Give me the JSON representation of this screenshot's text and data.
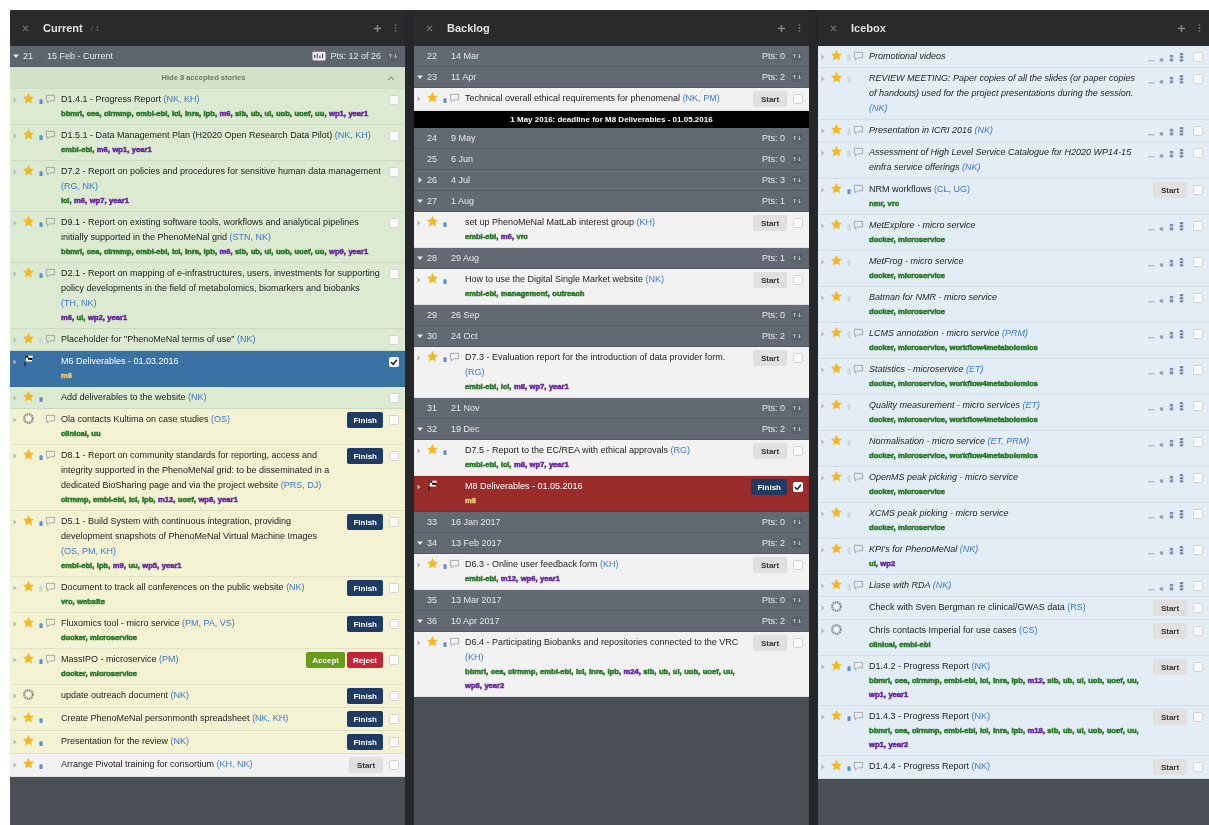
{
  "panels": [
    {
      "title": "Current",
      "count": "/ 1",
      "items": [
        {
          "kind": "iteration",
          "current": true,
          "expanded": true,
          "number": "21",
          "date": "15 Feb - Current",
          "points": "Pts: 12 of 26"
        },
        {
          "kind": "banner",
          "text": "Hide 8 accepted stories",
          "expanded": true
        },
        {
          "kind": "feature",
          "color": "#dbead0",
          "estimated": true,
          "comments": true,
          "title": "D1.4.1 - Progress Report",
          "owners": "(NK, KH)",
          "checked": false,
          "labels": [
            {
              "text": "bbmri,",
              "color": "#2f7a2f"
            },
            {
              "text": "cea,",
              "color": "#2f7a2f"
            },
            {
              "text": "cirmmp,",
              "color": "#2f7a2f"
            },
            {
              "text": "embl-ebi,",
              "color": "#2f7a2f"
            },
            {
              "text": "icl,",
              "color": "#2f7a2f"
            },
            {
              "text": "inra,",
              "color": "#2f7a2f"
            },
            {
              "text": "ipb,",
              "color": "#2f7a2f"
            },
            {
              "text": "m6,",
              "color": "#6a2c9e"
            },
            {
              "text": "sib,",
              "color": "#2f7a2f"
            },
            {
              "text": "ub,",
              "color": "#2f7a2f"
            },
            {
              "text": "ul,",
              "color": "#2f7a2f"
            },
            {
              "text": "uob,",
              "color": "#2f7a2f"
            },
            {
              "text": "uoef,",
              "color": "#2f7a2f"
            },
            {
              "text": "uu,",
              "color": "#2f7a2f"
            },
            {
              "text": "wp1,",
              "color": "#6a2c9e"
            },
            {
              "text": "year1",
              "color": "#6a2c9e"
            }
          ]
        },
        {
          "kind": "feature",
          "color": "#dbead0",
          "estimated": true,
          "comments": true,
          "title": "D1.5.1 - Data Management Plan (H2020 Open Research Data Pilot)",
          "owners": "(NK, KH)",
          "checked": false,
          "labels": [
            {
              "text": "embl-ebi,",
              "color": "#2f7a2f"
            },
            {
              "text": "m6,",
              "color": "#6a2c9e"
            },
            {
              "text": "wp1,",
              "color": "#6a2c9e"
            },
            {
              "text": "year1",
              "color": "#6a2c9e"
            }
          ]
        },
        {
          "kind": "feature",
          "color": "#dbead0",
          "estimated": true,
          "comments": true,
          "title": "D7.2 - Report on policies and procedures for sensitive human data management",
          "owners": "(RG, NK)",
          "checked": false,
          "labels": [
            {
              "text": "icl,",
              "color": "#2f7a2f"
            },
            {
              "text": "m6,",
              "color": "#6a2c9e"
            },
            {
              "text": "wp7,",
              "color": "#6a2c9e"
            },
            {
              "text": "year1",
              "color": "#6a2c9e"
            }
          ]
        },
        {
          "kind": "feature",
          "color": "#dbead0",
          "estimated": true,
          "comments": true,
          "title": "D9.1 - Report on existing software tools, workflows and analytical pipelines initially supported in the PhenoMeNal grid",
          "owners": "(STN, NK)",
          "checked": false,
          "labels": [
            {
              "text": "bbmri,",
              "color": "#2f7a2f"
            },
            {
              "text": "cea,",
              "color": "#2f7a2f"
            },
            {
              "text": "cirmmp,",
              "color": "#2f7a2f"
            },
            {
              "text": "embl-ebi,",
              "color": "#2f7a2f"
            },
            {
              "text": "icl,",
              "color": "#2f7a2f"
            },
            {
              "text": "inra,",
              "color": "#2f7a2f"
            },
            {
              "text": "ipb,",
              "color": "#2f7a2f"
            },
            {
              "text": "m6,",
              "color": "#6a2c9e"
            },
            {
              "text": "sib,",
              "color": "#2f7a2f"
            },
            {
              "text": "ub,",
              "color": "#2f7a2f"
            },
            {
              "text": "ul,",
              "color": "#2f7a2f"
            },
            {
              "text": "uob,",
              "color": "#2f7a2f"
            },
            {
              "text": "uoef,",
              "color": "#2f7a2f"
            },
            {
              "text": "uu,",
              "color": "#2f7a2f"
            },
            {
              "text": "wp9,",
              "color": "#6a2c9e"
            },
            {
              "text": "year1",
              "color": "#6a2c9e"
            }
          ]
        },
        {
          "kind": "feature",
          "color": "#dbead0",
          "estimated": true,
          "comments": true,
          "title": "D2.1 - Report on mapping of e-infrastructures, users, investments for supporting policy developments in the field of metabolomics, biomarkers and biobanks",
          "owners": "(TH, NK)",
          "checked": false,
          "labels": [
            {
              "text": "m6,",
              "color": "#6a2c9e"
            },
            {
              "text": "ul,",
              "color": "#2f7a2f"
            },
            {
              "text": "wp2,",
              "color": "#6a2c9e"
            },
            {
              "text": "year1",
              "color": "#6a2c9e"
            }
          ]
        },
        {
          "kind": "feature",
          "color": "#dbead0",
          "estimated": false,
          "comments": true,
          "title": "Placeholder for \"PhenoMeNal terms of use\"",
          "owners": "(NK)",
          "checked": false
        },
        {
          "kind": "release",
          "color": "#3a72a3",
          "title": "M6 Deliverables - 01.03.2016",
          "checked": true,
          "labels": [
            {
              "text": "m6",
              "color": "#e9c46a"
            }
          ]
        },
        {
          "kind": "feature",
          "color": "#dbead0",
          "estimated": true,
          "comments": false,
          "title": "Add deliverables to the website",
          "owners": "(NK)",
          "checked": false
        },
        {
          "kind": "chore",
          "color": "#f3f2d3",
          "comments": true,
          "title": "Ola contacts Kultima on case studies",
          "owners": "(OS)",
          "checked": false,
          "actions": [
            {
              "label": "Finish",
              "kind": "finish"
            }
          ],
          "labels": [
            {
              "text": "clinical,",
              "color": "#2f7a2f"
            },
            {
              "text": "uu",
              "color": "#2f7a2f"
            }
          ]
        },
        {
          "kind": "feature",
          "color": "#f3f2d3",
          "estimated": true,
          "comments": true,
          "title": "D8.1 - Report on community standards for reporting, access and integrity supported in the PhenoMeNal grid: to be disseminated in a dedicated BioSharing page and via the project website",
          "owners": "(PRS, DJ)",
          "checked": false,
          "actions": [
            {
              "label": "Finish",
              "kind": "finish"
            }
          ],
          "labels": [
            {
              "text": "cirmmp,",
              "color": "#2f7a2f"
            },
            {
              "text": "embl-ebi,",
              "color": "#2f7a2f"
            },
            {
              "text": "icl,",
              "color": "#2f7a2f"
            },
            {
              "text": "ipb,",
              "color": "#2f7a2f"
            },
            {
              "text": "m12,",
              "color": "#6a2c9e"
            },
            {
              "text": "uoef,",
              "color": "#2f7a2f"
            },
            {
              "text": "wp8,",
              "color": "#6a2c9e"
            },
            {
              "text": "year1",
              "color": "#6a2c9e"
            }
          ]
        },
        {
          "kind": "feature",
          "color": "#f3f2d3",
          "estimated": true,
          "comments": true,
          "title": "D5.1 - Build System with continuous integration, providing development snapshots of PhenoMeNal Virtual Machine Images",
          "owners": "(OS, PM, KH)",
          "checked": false,
          "actions": [
            {
              "label": "Finish",
              "kind": "finish"
            }
          ],
          "labels": [
            {
              "text": "embl-ebi,",
              "color": "#2f7a2f"
            },
            {
              "text": "ipb,",
              "color": "#2f7a2f"
            },
            {
              "text": "m9,",
              "color": "#6a2c9e"
            },
            {
              "text": "uu,",
              "color": "#2f7a2f"
            },
            {
              "text": "wp5,",
              "color": "#6a2c9e"
            },
            {
              "text": "year1",
              "color": "#6a2c9e"
            }
          ]
        },
        {
          "kind": "feature",
          "color": "#f3f2d3",
          "estimated": false,
          "comments": true,
          "title": "Document to track all conferences on the public website",
          "owners": "(NK)",
          "checked": false,
          "actions": [
            {
              "label": "Finish",
              "kind": "finish"
            }
          ],
          "labels": [
            {
              "text": "vrc,",
              "color": "#2f7a2f"
            },
            {
              "text": "website",
              "color": "#2f7a2f"
            }
          ]
        },
        {
          "kind": "feature",
          "color": "#f3f2d3",
          "estimated": true,
          "comments": true,
          "title": "Fluxomics tool - micro service",
          "owners": "(PM, PA, VS)",
          "checked": false,
          "actions": [
            {
              "label": "Finish",
              "kind": "finish"
            }
          ],
          "labels": [
            {
              "text": "docker,",
              "color": "#2f7a2f"
            },
            {
              "text": "microservice",
              "color": "#2f7a2f"
            }
          ]
        },
        {
          "kind": "feature",
          "color": "#f3f2d3",
          "estimated": true,
          "comments": true,
          "title": "MassIPO - microservice",
          "owners": "(PM)",
          "checked": false,
          "actions": [
            {
              "label": "Accept",
              "kind": "accept"
            },
            {
              "label": "Reject",
              "kind": "reject"
            }
          ],
          "labels": [
            {
              "text": "docker,",
              "color": "#2f7a2f"
            },
            {
              "text": "microservice",
              "color": "#2f7a2f"
            }
          ]
        },
        {
          "kind": "chore",
          "color": "#f3f2d3",
          "comments": false,
          "title": "update outreach document",
          "owners": "(NK)",
          "checked": false,
          "actions": [
            {
              "label": "Finish",
              "kind": "finish"
            }
          ]
        },
        {
          "kind": "feature",
          "color": "#f3f2d3",
          "estimated": true,
          "comments": false,
          "title": "Create PhenoMeNal personmonth spreadsheet",
          "owners": "(NK, KH)",
          "checked": false,
          "actions": [
            {
              "label": "Finish",
              "kind": "finish"
            }
          ]
        },
        {
          "kind": "feature",
          "color": "#f3f2d3",
          "estimated": true,
          "comments": false,
          "title": "Presentation for the review",
          "owners": "(NK)",
          "checked": false,
          "actions": [
            {
              "label": "Finish",
              "kind": "finish"
            }
          ]
        },
        {
          "kind": "feature",
          "color": "#f2f2f2",
          "estimated": true,
          "comments": false,
          "title": "Arrange Pivotal training for consortium",
          "owners": "(KH, NK)",
          "checked": false,
          "actions": [
            {
              "label": "Start",
              "kind": "start"
            }
          ]
        }
      ]
    },
    {
      "title": "Backlog",
      "items": [
        {
          "kind": "iteration",
          "current": false,
          "number": "22",
          "date": "14 Mar",
          "points": "Pts: 0"
        },
        {
          "kind": "iteration",
          "current": false,
          "expanded": true,
          "number": "23",
          "date": "11 Apr",
          "points": "Pts: 2"
        },
        {
          "kind": "feature",
          "color": "#f2f2f2",
          "estimated": true,
          "comments": true,
          "title": "Technical overall ethical requirements for phenomenal",
          "owners": "(NK, PM)",
          "checked": false,
          "actions": [
            {
              "label": "Start",
              "kind": "start"
            }
          ]
        },
        {
          "kind": "marker",
          "text": "1 May 2016: deadline for M8 Deliverables - 01.05.2016"
        },
        {
          "kind": "iteration",
          "current": false,
          "number": "24",
          "date": "9 May",
          "points": "Pts: 0"
        },
        {
          "kind": "iteration",
          "current": false,
          "number": "25",
          "date": "6 Jun",
          "points": "Pts: 0"
        },
        {
          "kind": "iteration",
          "current": false,
          "expanded": false,
          "number": "26",
          "date": "4 Jul",
          "points": "Pts: 3"
        },
        {
          "kind": "iteration",
          "current": false,
          "expanded": true,
          "number": "27",
          "date": "1 Aug",
          "points": "Pts: 1"
        },
        {
          "kind": "feature",
          "color": "#f2f2f2",
          "estimated": true,
          "comments": false,
          "title": "set up PhenoMeNal MatLab interest group",
          "owners": "(KH)",
          "checked": false,
          "actions": [
            {
              "label": "Start",
              "kind": "start"
            }
          ],
          "labels": [
            {
              "text": "embl-ebi,",
              "color": "#2f7a2f"
            },
            {
              "text": "m6,",
              "color": "#6a2c9e"
            },
            {
              "text": "vrc",
              "color": "#2f7a2f"
            }
          ]
        },
        {
          "kind": "iteration",
          "current": false,
          "expanded": true,
          "number": "28",
          "date": "29 Aug",
          "points": "Pts: 1"
        },
        {
          "kind": "feature",
          "color": "#f2f2f2",
          "estimated": true,
          "comments": false,
          "title": "How to use the Digital Single Market website",
          "owners": "(NK)",
          "checked": false,
          "actions": [
            {
              "label": "Start",
              "kind": "start"
            }
          ],
          "labels": [
            {
              "text": "embl-ebi,",
              "color": "#2f7a2f"
            },
            {
              "text": "management,",
              "color": "#2f7a2f"
            },
            {
              "text": "outreach",
              "color": "#2f7a2f"
            }
          ]
        },
        {
          "kind": "iteration",
          "current": false,
          "number": "29",
          "date": "26 Sep",
          "points": "Pts: 0"
        },
        {
          "kind": "iteration",
          "current": false,
          "expanded": true,
          "number": "30",
          "date": "24 Oct",
          "points": "Pts: 2"
        },
        {
          "kind": "feature",
          "color": "#f2f2f2",
          "estimated": true,
          "comments": true,
          "title": "D7.3 - Evaluation report for the introduction of data provider form.",
          "owners": "(RG)",
          "checked": false,
          "actions": [
            {
              "label": "Start",
              "kind": "start"
            }
          ],
          "labels": [
            {
              "text": "embl-ebi,",
              "color": "#2f7a2f"
            },
            {
              "text": "icl,",
              "color": "#2f7a2f"
            },
            {
              "text": "m8,",
              "color": "#6a2c9e"
            },
            {
              "text": "wp7,",
              "color": "#6a2c9e"
            },
            {
              "text": "year1",
              "color": "#6a2c9e"
            }
          ]
        },
        {
          "kind": "iteration",
          "current": false,
          "number": "31",
          "date": "21 Nov",
          "points": "Pts: 0"
        },
        {
          "kind": "iteration",
          "current": false,
          "expanded": true,
          "number": "32",
          "date": "19 Dec",
          "points": "Pts: 2"
        },
        {
          "kind": "feature",
          "color": "#f2f2f2",
          "estimated": true,
          "comments": false,
          "title": "D7.5 - Report to the EC/REA with ethical approvals",
          "owners": "(RG)",
          "checked": false,
          "actions": [
            {
              "label": "Start",
              "kind": "start"
            }
          ],
          "labels": [
            {
              "text": "embl-ebi,",
              "color": "#2f7a2f"
            },
            {
              "text": "icl,",
              "color": "#2f7a2f"
            },
            {
              "text": "m8,",
              "color": "#6a2c9e"
            },
            {
              "text": "wp7,",
              "color": "#6a2c9e"
            },
            {
              "text": "year1",
              "color": "#6a2c9e"
            }
          ]
        },
        {
          "kind": "release",
          "color": "#992c2b",
          "title": "M8 Deliverables - 01.05.2016",
          "checked": true,
          "actions": [
            {
              "label": "Finish",
              "kind": "finish"
            }
          ],
          "labels": [
            {
              "text": "m8",
              "color": "#e9c46a"
            }
          ]
        },
        {
          "kind": "iteration",
          "current": false,
          "number": "33",
          "date": "16 Jan 2017",
          "points": "Pts: 0"
        },
        {
          "kind": "iteration",
          "current": false,
          "expanded": true,
          "number": "34",
          "date": "13 Feb 2017",
          "points": "Pts: 2"
        },
        {
          "kind": "feature",
          "color": "#f2f2f2",
          "estimated": true,
          "comments": true,
          "title": "D6.3 - Online user feedback form",
          "owners": "(KH)",
          "checked": false,
          "actions": [
            {
              "label": "Start",
              "kind": "start"
            }
          ],
          "labels": [
            {
              "text": "embl-ebi,",
              "color": "#2f7a2f"
            },
            {
              "text": "m12,",
              "color": "#6a2c9e"
            },
            {
              "text": "wp6,",
              "color": "#6a2c9e"
            },
            {
              "text": "year1",
              "color": "#6a2c9e"
            }
          ]
        },
        {
          "kind": "iteration",
          "current": false,
          "number": "35",
          "date": "13 Mar 2017",
          "points": "Pts: 0"
        },
        {
          "kind": "iteration",
          "current": false,
          "expanded": true,
          "number": "36",
          "date": "10 Apr 2017",
          "points": "Pts: 2"
        },
        {
          "kind": "feature",
          "color": "#f2f2f2",
          "estimated": true,
          "comments": true,
          "title": "D6.4 - Participating Biobanks and repositories connected to the VRC",
          "owners": "(KH)",
          "checked": false,
          "actions": [
            {
              "label": "Start",
              "kind": "start"
            }
          ],
          "labels": [
            {
              "text": "bbmri,",
              "color": "#2f7a2f"
            },
            {
              "text": "cea,",
              "color": "#2f7a2f"
            },
            {
              "text": "cirmmp,",
              "color": "#2f7a2f"
            },
            {
              "text": "embl-ebi,",
              "color": "#2f7a2f"
            },
            {
              "text": "icl,",
              "color": "#2f7a2f"
            },
            {
              "text": "inra,",
              "color": "#2f7a2f"
            },
            {
              "text": "ipb,",
              "color": "#2f7a2f"
            },
            {
              "text": "m24,",
              "color": "#6a2c9e"
            },
            {
              "text": "sib,",
              "color": "#2f7a2f"
            },
            {
              "text": "ub,",
              "color": "#2f7a2f"
            },
            {
              "text": "ul,",
              "color": "#2f7a2f"
            },
            {
              "text": "uob,",
              "color": "#2f7a2f"
            },
            {
              "text": "uoef,",
              "color": "#2f7a2f"
            },
            {
              "text": "uu,",
              "color": "#2f7a2f"
            },
            {
              "text": "wp8,",
              "color": "#6a2c9e"
            },
            {
              "text": "year2",
              "color": "#6a2c9e"
            }
          ]
        }
      ]
    },
    {
      "title": "Icebox",
      "items": [
        {
          "kind": "feature",
          "color": "#e3edf6",
          "estimated": false,
          "comments": true,
          "estimate_picker": true,
          "title": "Promotional videos",
          "checked": false
        },
        {
          "kind": "feature",
          "color": "#e3edf6",
          "estimated": false,
          "comments": false,
          "estimate_picker": true,
          "title": "REVIEW MEETING: Paper copies of all the slides (or paper copies of handouts) used for the project presentations during the session.",
          "owners": "(NK)",
          "checked": false
        },
        {
          "kind": "feature",
          "color": "#e3edf6",
          "estimated": false,
          "comments": true,
          "estimate_picker": true,
          "title": "Presentation in ICRI 2016",
          "owners": "(NK)",
          "checked": false
        },
        {
          "kind": "feature",
          "color": "#e3edf6",
          "estimated": false,
          "comments": true,
          "estimate_picker": true,
          "title": "Assessment of High Level Service Catalogue for H2020 WP14-15 einfra service offerings",
          "owners": "(NK)",
          "checked": false
        },
        {
          "kind": "feature",
          "color": "#e3edf6",
          "estimated": true,
          "comments": true,
          "estimate_picker": false,
          "title": "NRM workflows",
          "owners": "(CL, UG)",
          "checked": false,
          "actions": [
            {
              "label": "Start",
              "kind": "start"
            }
          ],
          "labels": [
            {
              "text": "nmr,",
              "color": "#2f7a2f"
            },
            {
              "text": "vrc",
              "color": "#2f7a2f"
            }
          ]
        },
        {
          "kind": "feature",
          "color": "#e3edf6",
          "estimated": false,
          "comments": true,
          "estimate_picker": true,
          "title": "MetExplore - micro service",
          "checked": false,
          "labels": [
            {
              "text": "docker,",
              "color": "#2f7a2f"
            },
            {
              "text": "microservice",
              "color": "#2f7a2f"
            }
          ]
        },
        {
          "kind": "feature",
          "color": "#e3edf6",
          "estimated": false,
          "comments": false,
          "estimate_picker": true,
          "title": "MetFrog - micro service",
          "checked": false,
          "labels": [
            {
              "text": "docker,",
              "color": "#2f7a2f"
            },
            {
              "text": "microservice",
              "color": "#2f7a2f"
            }
          ]
        },
        {
          "kind": "feature",
          "color": "#e3edf6",
          "estimated": false,
          "comments": false,
          "estimate_picker": true,
          "title": "Batman for NMR - micro service",
          "checked": false,
          "labels": [
            {
              "text": "docker,",
              "color": "#2f7a2f"
            },
            {
              "text": "microservice",
              "color": "#2f7a2f"
            }
          ]
        },
        {
          "kind": "feature",
          "color": "#e3edf6",
          "estimated": false,
          "comments": true,
          "estimate_picker": true,
          "title": "LCMS annotation - micro service",
          "owners": "(PRM)",
          "checked": false,
          "labels": [
            {
              "text": "docker,",
              "color": "#2f7a2f"
            },
            {
              "text": "microservice,",
              "color": "#2f7a2f"
            },
            {
              "text": "workflow4metabolomics",
              "color": "#2f7a2f"
            }
          ]
        },
        {
          "kind": "feature",
          "color": "#e3edf6",
          "estimated": false,
          "comments": true,
          "estimate_picker": true,
          "title": "Statistics - microservice",
          "owners": "(ET)",
          "checked": false,
          "labels": [
            {
              "text": "docker,",
              "color": "#2f7a2f"
            },
            {
              "text": "microservice,",
              "color": "#2f7a2f"
            },
            {
              "text": "workflow4metabolomics",
              "color": "#2f7a2f"
            }
          ]
        },
        {
          "kind": "feature",
          "color": "#e3edf6",
          "estimated": false,
          "comments": false,
          "estimate_picker": true,
          "title": "Quality measurement - micro services",
          "owners": "(ET)",
          "checked": false,
          "labels": [
            {
              "text": "docker,",
              "color": "#2f7a2f"
            },
            {
              "text": "microservice,",
              "color": "#2f7a2f"
            },
            {
              "text": "workflow4metabolomics",
              "color": "#2f7a2f"
            }
          ]
        },
        {
          "kind": "feature",
          "color": "#e3edf6",
          "estimated": false,
          "comments": false,
          "estimate_picker": true,
          "title": "Normalisation - micro service",
          "owners": "(ET, PRM)",
          "checked": false,
          "labels": [
            {
              "text": "docker,",
              "color": "#2f7a2f"
            },
            {
              "text": "microservice,",
              "color": "#2f7a2f"
            },
            {
              "text": "workflow4metabolomics",
              "color": "#2f7a2f"
            }
          ]
        },
        {
          "kind": "feature",
          "color": "#e3edf6",
          "estimated": false,
          "comments": true,
          "estimate_picker": true,
          "title": "OpenMS peak picking - micro service",
          "checked": false,
          "labels": [
            {
              "text": "docker,",
              "color": "#2f7a2f"
            },
            {
              "text": "microservice",
              "color": "#2f7a2f"
            }
          ]
        },
        {
          "kind": "feature",
          "color": "#e3edf6",
          "estimated": false,
          "comments": false,
          "estimate_picker": true,
          "title": "XCMS peak picking - micro service",
          "checked": false,
          "labels": [
            {
              "text": "docker,",
              "color": "#2f7a2f"
            },
            {
              "text": "microservice",
              "color": "#2f7a2f"
            }
          ]
        },
        {
          "kind": "feature",
          "color": "#e3edf6",
          "estimated": false,
          "comments": true,
          "estimate_picker": true,
          "title": "KPI's for PhenoMeNal",
          "owners": "(NK)",
          "checked": false,
          "labels": [
            {
              "text": "ul,",
              "color": "#2f7a2f"
            },
            {
              "text": "wp2",
              "color": "#6a2c9e"
            }
          ]
        },
        {
          "kind": "feature",
          "color": "#e3edf6",
          "estimated": false,
          "comments": true,
          "estimate_picker": true,
          "title": "Liase with RDA",
          "owners": "(NK)",
          "checked": false
        },
        {
          "kind": "chore",
          "color": "#e3edf6",
          "comments": false,
          "title": "Check with Sven Bergman re clinical/GWAS data",
          "owners": "(RS)",
          "checked": false,
          "actions": [
            {
              "label": "Start",
              "kind": "start"
            }
          ]
        },
        {
          "kind": "chore",
          "color": "#e3edf6",
          "comments": false,
          "title": "Chris contacts Imperial for use cases",
          "owners": "(CS)",
          "checked": false,
          "actions": [
            {
              "label": "Start",
              "kind": "start"
            }
          ],
          "labels": [
            {
              "text": "clinical,",
              "color": "#2f7a2f"
            },
            {
              "text": "embl-ebi",
              "color": "#2f7a2f"
            }
          ]
        },
        {
          "kind": "feature",
          "color": "#e3edf6",
          "estimated": true,
          "comments": true,
          "title": "D1.4.2 - Progress Report",
          "owners": "(NK)",
          "checked": false,
          "actions": [
            {
              "label": "Start",
              "kind": "start"
            }
          ],
          "labels": [
            {
              "text": "bbmri,",
              "color": "#2f7a2f"
            },
            {
              "text": "cea,",
              "color": "#2f7a2f"
            },
            {
              "text": "cirmmp,",
              "color": "#2f7a2f"
            },
            {
              "text": "embl-ebi,",
              "color": "#2f7a2f"
            },
            {
              "text": "icl,",
              "color": "#2f7a2f"
            },
            {
              "text": "inra,",
              "color": "#2f7a2f"
            },
            {
              "text": "ipb,",
              "color": "#2f7a2f"
            },
            {
              "text": "m12,",
              "color": "#6a2c9e"
            },
            {
              "text": "sib,",
              "color": "#2f7a2f"
            },
            {
              "text": "ub,",
              "color": "#2f7a2f"
            },
            {
              "text": "ul,",
              "color": "#2f7a2f"
            },
            {
              "text": "uob,",
              "color": "#2f7a2f"
            },
            {
              "text": "uoef,",
              "color": "#2f7a2f"
            },
            {
              "text": "uu,",
              "color": "#2f7a2f"
            },
            {
              "text": "wp1,",
              "color": "#6a2c9e"
            },
            {
              "text": "year1",
              "color": "#6a2c9e"
            }
          ]
        },
        {
          "kind": "feature",
          "color": "#e3edf6",
          "estimated": true,
          "comments": true,
          "title": "D1.4.3 - Progress Report",
          "owners": "(NK)",
          "checked": false,
          "actions": [
            {
              "label": "Start",
              "kind": "start"
            }
          ],
          "labels": [
            {
              "text": "bbmri,",
              "color": "#2f7a2f"
            },
            {
              "text": "cea,",
              "color": "#2f7a2f"
            },
            {
              "text": "cirmmp,",
              "color": "#2f7a2f"
            },
            {
              "text": "embl-ebi,",
              "color": "#2f7a2f"
            },
            {
              "text": "icl,",
              "color": "#2f7a2f"
            },
            {
              "text": "inra,",
              "color": "#2f7a2f"
            },
            {
              "text": "ipb,",
              "color": "#2f7a2f"
            },
            {
              "text": "m18,",
              "color": "#6a2c9e"
            },
            {
              "text": "sib,",
              "color": "#2f7a2f"
            },
            {
              "text": "ub,",
              "color": "#2f7a2f"
            },
            {
              "text": "ul,",
              "color": "#2f7a2f"
            },
            {
              "text": "uob,",
              "color": "#2f7a2f"
            },
            {
              "text": "uoef,",
              "color": "#2f7a2f"
            },
            {
              "text": "uu,",
              "color": "#2f7a2f"
            },
            {
              "text": "wp1,",
              "color": "#6a2c9e"
            },
            {
              "text": "year2",
              "color": "#6a2c9e"
            }
          ]
        },
        {
          "kind": "feature",
          "color": "#e3edf6",
          "estimated": true,
          "comments": true,
          "title": "D1.4.4 - Progress Report",
          "owners": "(NK)",
          "checked": false,
          "actions": [
            {
              "label": "Start",
              "kind": "start"
            }
          ]
        }
      ]
    }
  ]
}
